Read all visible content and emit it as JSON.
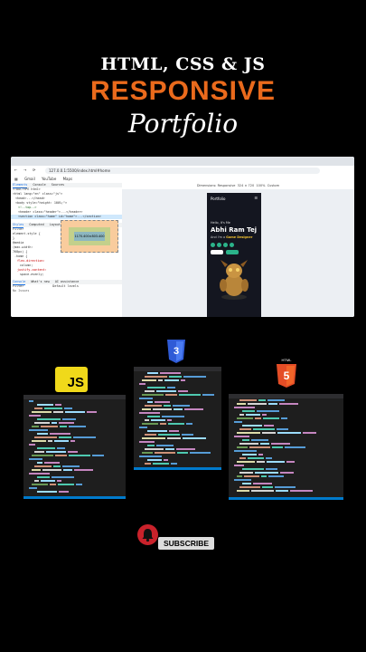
{
  "title": {
    "line1": "HTML, CSS & JS",
    "line2": "RESPONSIVE",
    "line3": "Portfolio"
  },
  "colors": {
    "accent": "#ea6a1c",
    "background": "#000000",
    "js_badge": "#f0d91a",
    "subscribe_red": "#c9222b"
  },
  "browser": {
    "url": "127.0.0.1:5500/index.html#home",
    "bookmarks": [
      "Gmail",
      "YouTube",
      "Maps"
    ],
    "devtools": {
      "tabs": [
        "Elements",
        "Console",
        "Sources"
      ],
      "code_lines": [
        "<!DOCTYPE html>",
        "<html lang=\"en\" class=\"js\">",
        "<head>...</head>",
        "<body style=\"height: 100%;\">",
        "<!--top-->",
        "<header class=\"header\">...</header>",
        "<section class=\"home\" id=\"home\">...</section>"
      ],
      "panel_tabs": [
        "Styles",
        "Computed",
        "Layout",
        "Event Listeners"
      ],
      "filter_placeholder": "Filter",
      "style_lines": [
        "element.style {",
        "}",
        "@media",
        "(max-width:",
        "768px) {",
        ".home {",
        "flex-direction:",
        "column;",
        "justify-content:",
        "space-evenly;"
      ],
      "box_value": "1170.400×803.400",
      "console_tabs": [
        "Console",
        "What's new",
        "AI assistance"
      ],
      "console_filter": "Filter",
      "console_level": "Default levels",
      "console_issues": "No Issues"
    },
    "viewport": {
      "dimensions_label": "Dimensions: Responsive",
      "width": "324",
      "height": "720",
      "zoom": "100%",
      "throttle": "Custom",
      "phone": {
        "logo": "Portfolio",
        "hello": "Hello, It's Me",
        "name": "Abhi Ram Tej",
        "role_prefix": "And I'm a",
        "role_highlight": "Game Designer"
      }
    }
  },
  "badges": {
    "js": "JS",
    "css": "CSS3",
    "html": "HTML5"
  },
  "subscribe": {
    "label": "SUBSCRIBE"
  }
}
